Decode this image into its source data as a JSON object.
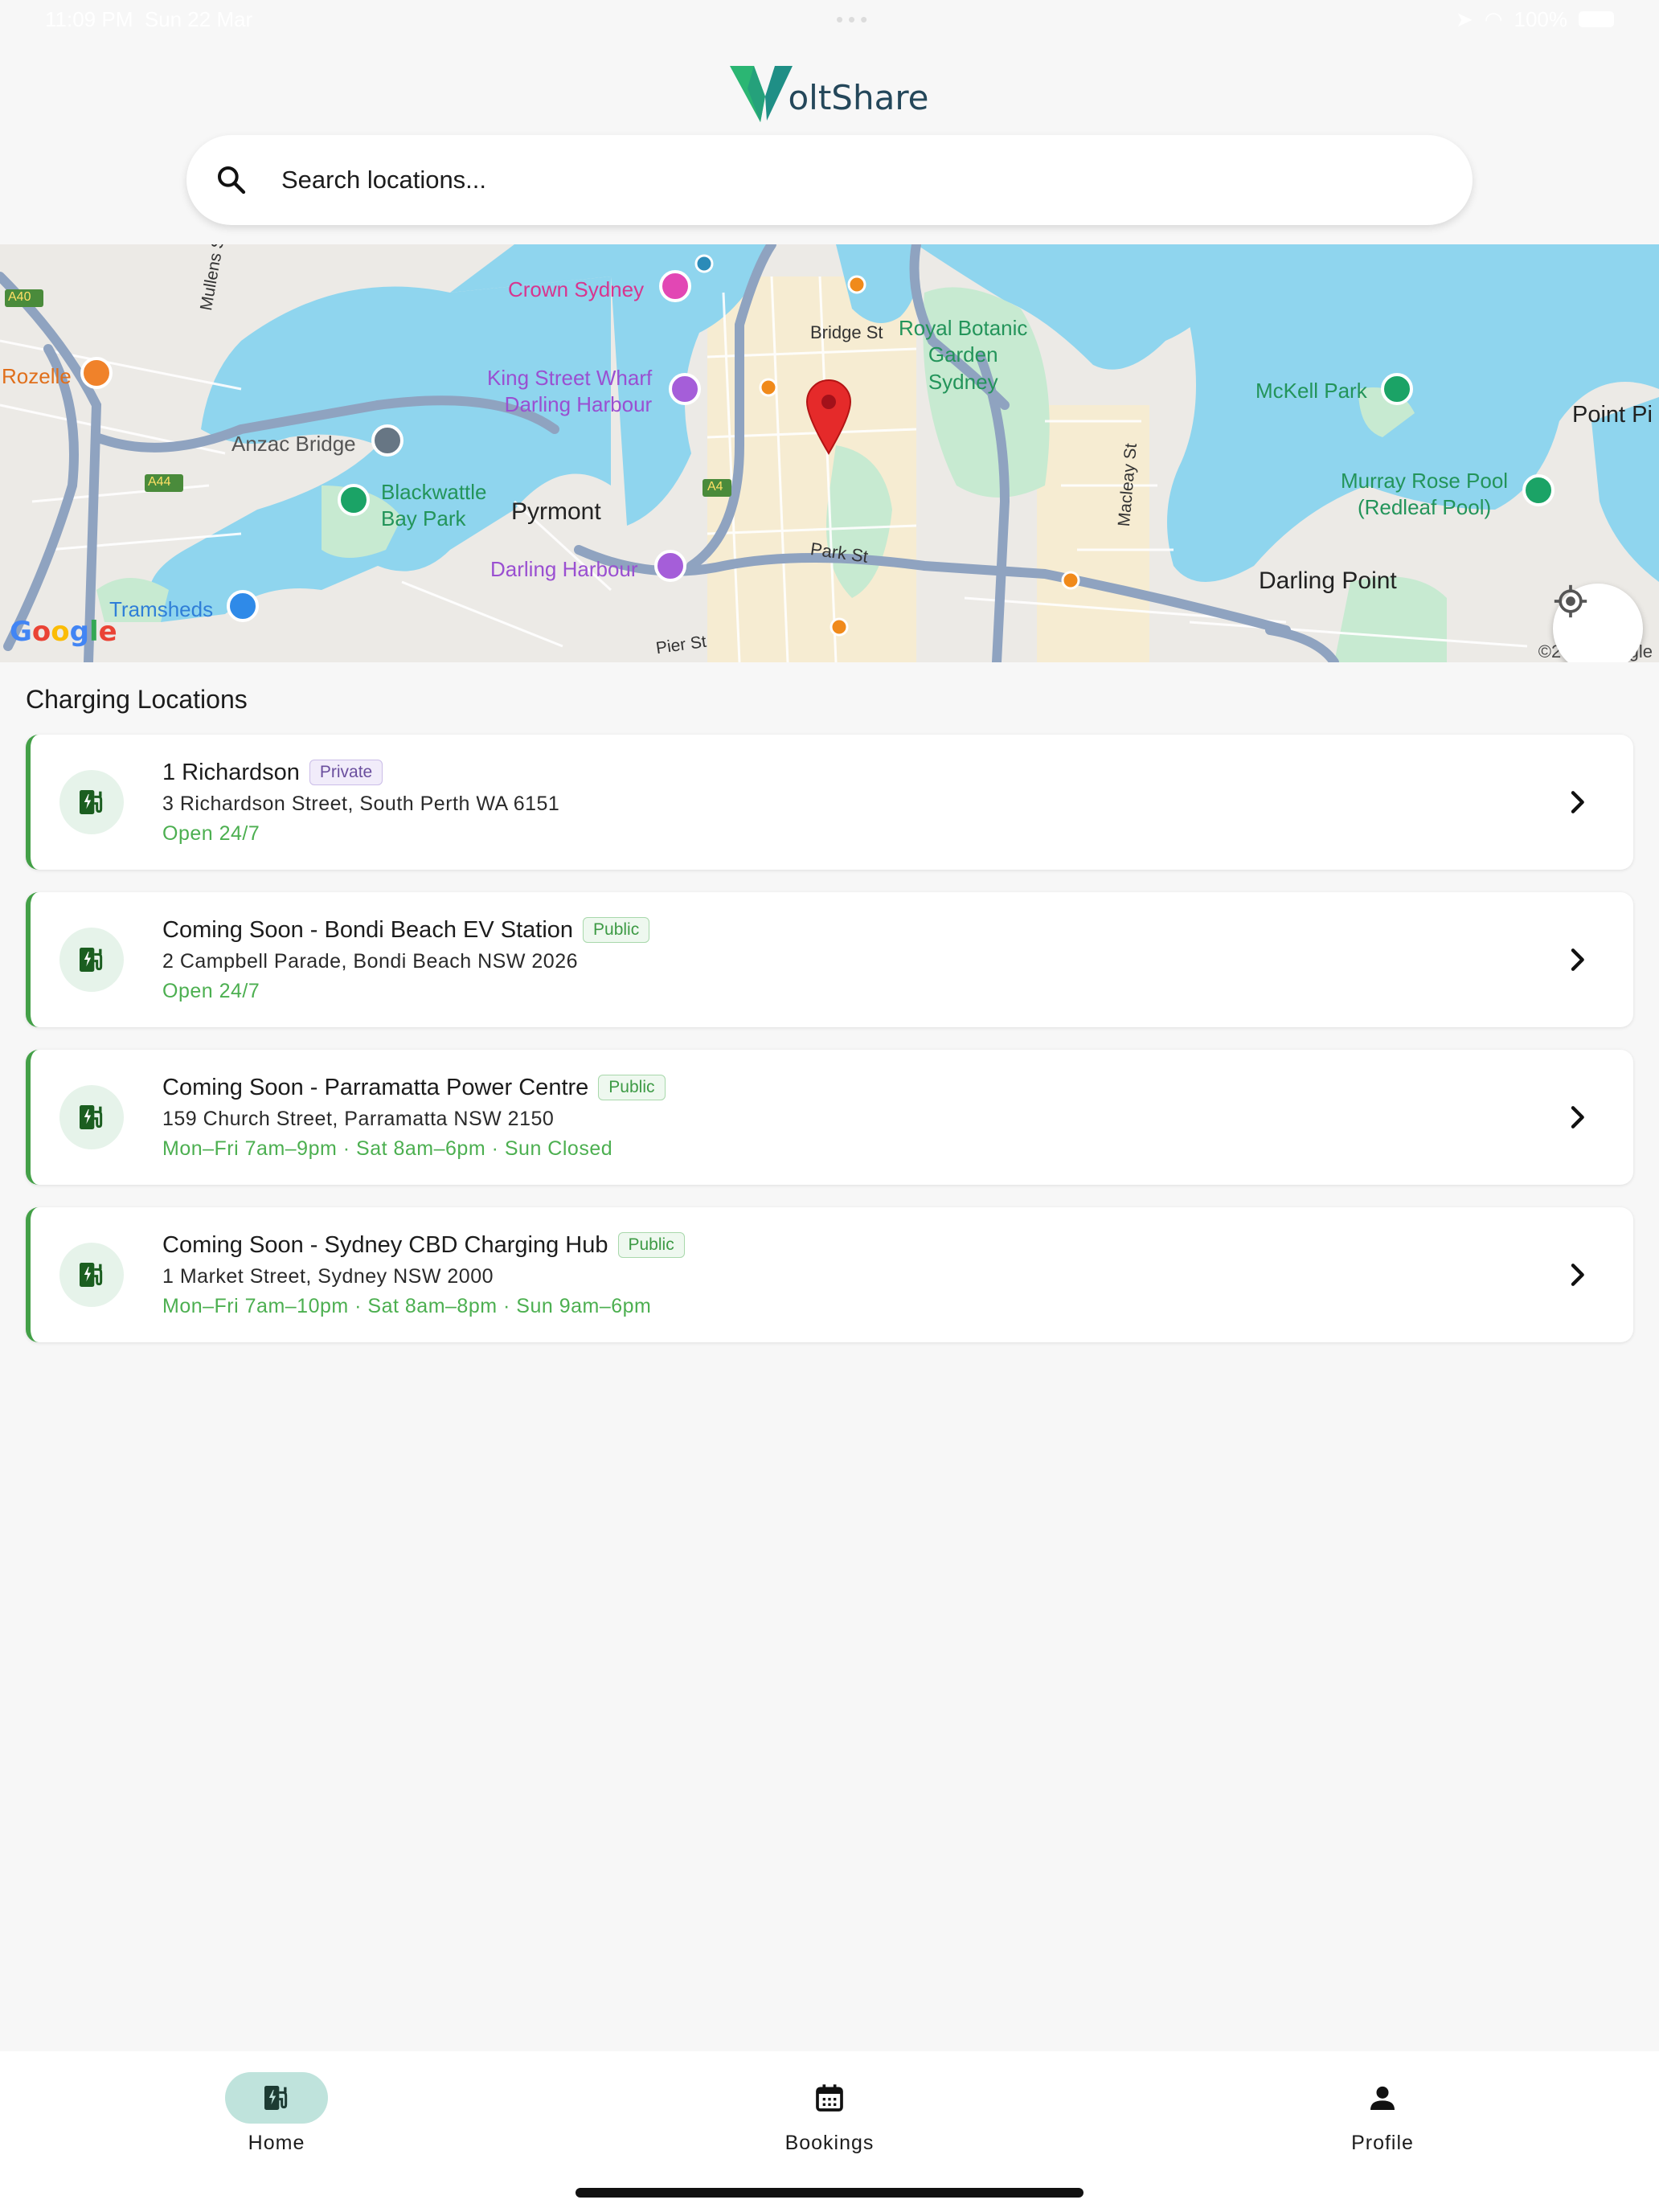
{
  "status_bar": {
    "time": "11:09 PM",
    "date": "Sun 22 Mar",
    "battery": "100%"
  },
  "brand": {
    "name_rest": "oltShare",
    "primary_color": "#2bb673",
    "text_color": "#24475a"
  },
  "search": {
    "placeholder": "Search locations..."
  },
  "map": {
    "labels": {
      "crown_sydney": "Crown Sydney",
      "rozelle": "Rozelle",
      "mullens_st": "Mullens St",
      "king_street_wharf": "King Street Wharf\nDarling Harbour",
      "bridge_st": "Bridge St",
      "royal_botanic": "Royal Botanic\nGarden\nSydney",
      "mckell_park": "McKell Park",
      "point_pi": "Point Pi",
      "anzac_bridge": "Anzac Bridge",
      "blackwattle": "Blackwattle\nBay Park",
      "pyrmont": "Pyrmont",
      "macleay_st": "Macleay St",
      "murray_rose": "Murray Rose Pool\n(Redleaf Pool)",
      "park_st": "Park St",
      "darling_harbour": "Darling Harbour",
      "darling_point": "Darling Point",
      "tramsheds": "Tramsheds",
      "pier_st": "Pier St",
      "road_a40": "A40",
      "road_a44": "A44",
      "road_a4": "A4"
    },
    "google_logo": "Google",
    "copyright": "©2026 Google"
  },
  "section_title": "Charging Locations",
  "locations": [
    {
      "name": "1 Richardson",
      "badge": "Private",
      "address": "3 Richardson Street, South Perth WA 6151",
      "hours": "Open 24/7"
    },
    {
      "name": "Coming Soon - Bondi Beach EV Station",
      "badge": "Public",
      "address": "2 Campbell Parade, Bondi Beach NSW 2026",
      "hours": "Open 24/7"
    },
    {
      "name": "Coming Soon - Parramatta Power Centre",
      "badge": "Public",
      "address": "159 Church Street, Parramatta NSW 2150",
      "hours": "Mon–Fri 7am–9pm · Sat 8am–6pm · Sun Closed"
    },
    {
      "name": "Coming Soon - Sydney CBD Charging Hub",
      "badge": "Public",
      "address": "1 Market Street, Sydney NSW 2000",
      "hours": "Mon–Fri 7am–10pm · Sat 8am–8pm · Sun 9am–6pm"
    }
  ],
  "nav": {
    "home": {
      "label": "Home",
      "icon": "ev-station-icon"
    },
    "bookings": {
      "label": "Bookings",
      "icon": "calendar-icon"
    },
    "profile": {
      "label": "Profile",
      "icon": "person-icon"
    }
  },
  "colors": {
    "accent_green": "#43a047",
    "hours_green": "#4caf50",
    "nav_active": "#bfe3dc",
    "water": "#8fd5ee",
    "park": "#c7ead1"
  }
}
